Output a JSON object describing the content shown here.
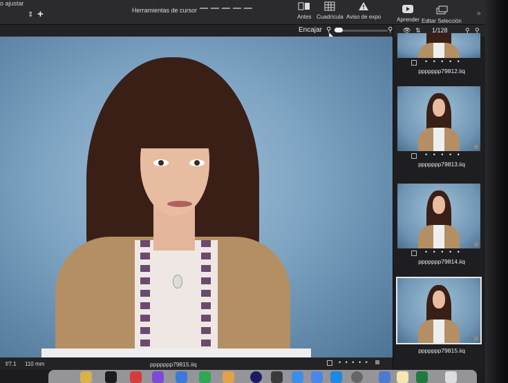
{
  "toolbar": {
    "crumb": "o ajustar",
    "cursor_tools_label": "Herramientas de cursor",
    "before_label": "Antes",
    "grid_label": "Cuadrícula",
    "exposure_warning_label": "Aviso de expo",
    "learn_label": "Aprender",
    "edit_selection_label": "Editar Selección",
    "more_icon": "chevron-double-right-icon"
  },
  "fitbar": {
    "fit_label": "Encajar",
    "zoom_level": 0.05
  },
  "browser": {
    "counter": "1/128",
    "thumbnails": [
      {
        "name": "ppppppp79812.iiq",
        "selected": false
      },
      {
        "name": "ppppppp79813.iiq",
        "selected": false
      },
      {
        "name": "ppppppp79814.iiq",
        "selected": false
      },
      {
        "name": "ppppppp79815.iiq",
        "selected": true
      }
    ],
    "dots": "• • • • •"
  },
  "viewer": {
    "aperture": "f/7.1",
    "focal_length": "110 mm",
    "filename": "ppppppp79815.iiq",
    "dots": "• • • • •"
  },
  "colors": {
    "toolbar_bg": "#2b2b2d",
    "backdrop": "#7ea4c3",
    "selection_outline": "#e8e8e8"
  }
}
